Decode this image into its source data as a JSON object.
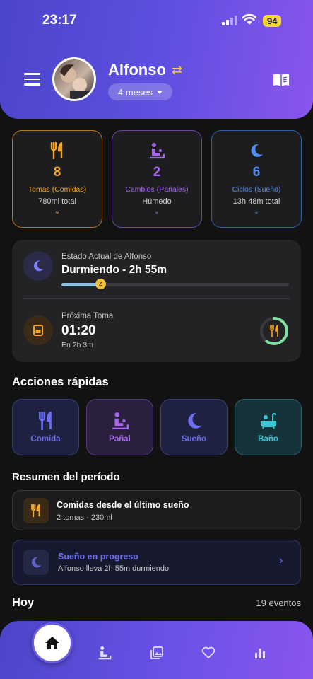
{
  "status_bar": {
    "time": "23:17",
    "battery": "94"
  },
  "header": {
    "name": "Alfonso",
    "age": "4 meses"
  },
  "stats": [
    {
      "value": "8",
      "label": "Tomas (Comidas)",
      "sub": "780ml total",
      "color": "#f5a524",
      "border": "#b7791f",
      "icon": "fork-knife-icon"
    },
    {
      "value": "2",
      "label": "Cambios (Pañales)",
      "sub": "Húmedo",
      "color": "#a566f0",
      "border": "#6b46a8",
      "icon": "changing-table-icon"
    },
    {
      "value": "6",
      "label": "Ciclos (Sueño)",
      "sub": "13h 48m total",
      "color": "#4f8ff5",
      "border": "#2f5fae",
      "icon": "moon-icon"
    }
  ],
  "current_state": {
    "label": "Estado Actual de Alfonso",
    "value": "Durmiendo - 2h 55m",
    "progress": 0.17,
    "next_label": "Próxima Toma",
    "next_value": "01:20",
    "next_sub": "En 2h 3m",
    "ring_progress": 0.6
  },
  "quick_actions": {
    "title": "Acciones rápidas",
    "items": [
      {
        "label": "Comida",
        "color": "#6b6ff0",
        "bg": "#1f2140",
        "border": "#3b3e7a"
      },
      {
        "label": "Pañal",
        "color": "#a566f0",
        "bg": "#2a1f3d",
        "border": "#553a80"
      },
      {
        "label": "Sueño",
        "color": "#6b6ff0",
        "bg": "#1f2140",
        "border": "#3b3e7a"
      },
      {
        "label": "Baño",
        "color": "#3ec6d6",
        "bg": "#16333a",
        "border": "#2c6470"
      }
    ]
  },
  "summary": {
    "title": "Resumen del período",
    "feeding": {
      "title": "Comidas desde el último sueño",
      "sub": "2 tomas · 230ml"
    },
    "sleep": {
      "title": "Sueño en progreso",
      "sub": "Alfonso lleva 2h 55m durmiendo"
    }
  },
  "today": {
    "title": "Hoy",
    "count": "19 eventos"
  },
  "colors": {
    "accent": "#5d4fe0",
    "background": "#121212",
    "card": "#232325"
  }
}
